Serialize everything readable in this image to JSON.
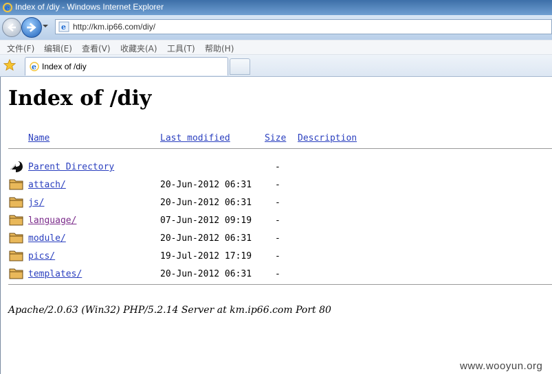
{
  "window": {
    "title": "Index of /diy - Windows Internet Explorer",
    "address": "http://km.ip66.com/diy/"
  },
  "menu": [
    "文件(F)",
    "编辑(E)",
    "查看(V)",
    "收藏夹(A)",
    "工具(T)",
    "帮助(H)"
  ],
  "tab": {
    "label": "Index of /diy"
  },
  "page": {
    "heading": "Index of /diy",
    "columns": {
      "name": "Name",
      "modified": "Last modified",
      "size": "Size",
      "description": "Description"
    },
    "parent": {
      "label": "Parent Directory",
      "size": "-"
    },
    "rows": [
      {
        "name": "attach/",
        "modified": "20-Jun-2012 06:31",
        "size": "-"
      },
      {
        "name": "js/",
        "modified": "20-Jun-2012 06:31",
        "size": "-"
      },
      {
        "name": "language/",
        "modified": "07-Jun-2012 09:19",
        "size": "-"
      },
      {
        "name": "module/",
        "modified": "20-Jun-2012 06:31",
        "size": "-"
      },
      {
        "name": "pics/",
        "modified": "19-Jul-2012 17:19",
        "size": "-"
      },
      {
        "name": "templates/",
        "modified": "20-Jun-2012 06:31",
        "size": "-"
      }
    ],
    "server_signature": "Apache/2.0.63 (Win32) PHP/5.2.14 Server at km.ip66.com Port 80"
  },
  "watermark": "www.wooyun.org",
  "colors": {
    "link": "#2a3fbf",
    "visited": "#7a2a8a",
    "titlebar": "#3d6fa8"
  }
}
